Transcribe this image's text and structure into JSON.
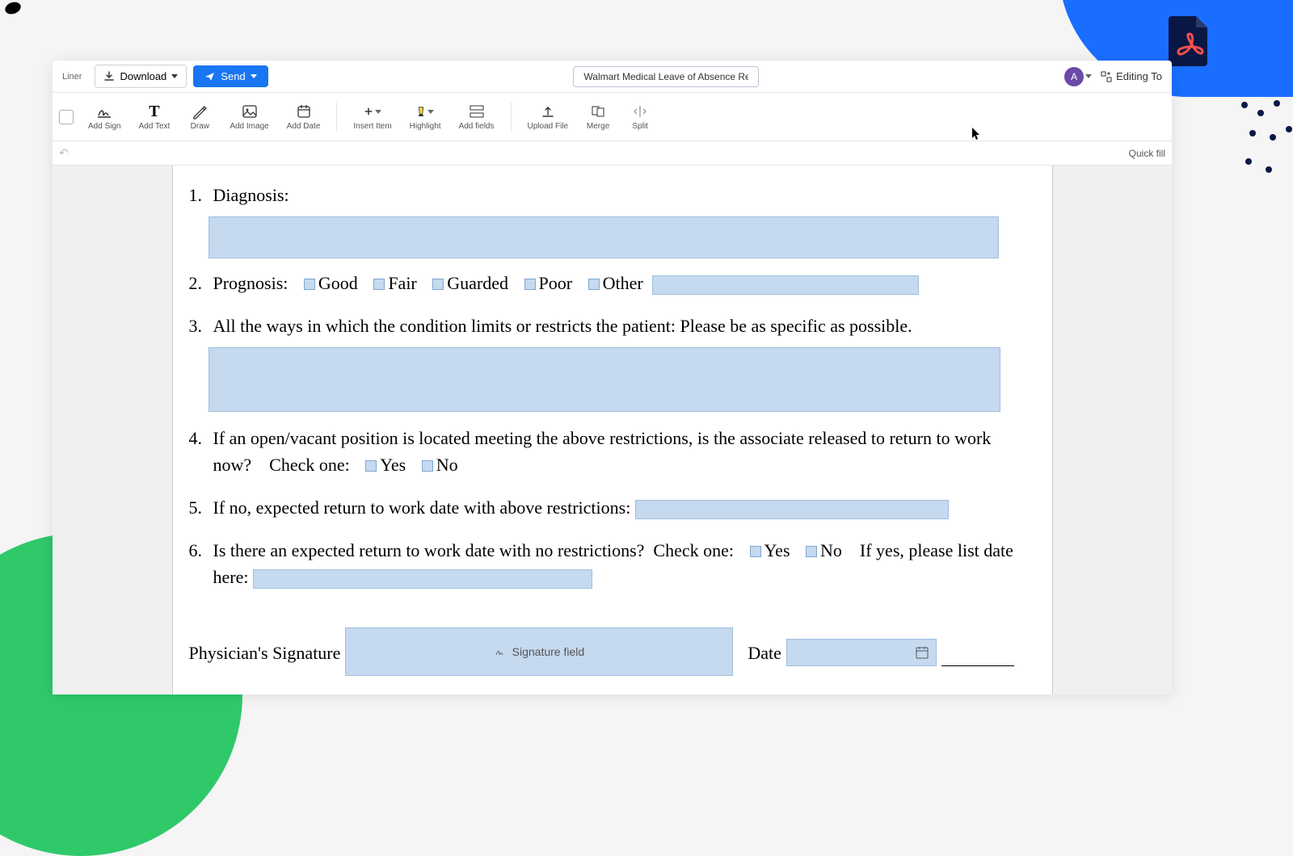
{
  "header": {
    "liner_label": "Liner",
    "download_label": "Download",
    "send_label": "Send",
    "document_title": "Walmart Medical Leave of Absence Request Form",
    "avatar_letter": "A",
    "editing_label": "Editing To"
  },
  "toolbar": {
    "add_sign": "Add Sign",
    "add_text": "Add Text",
    "draw": "Draw",
    "add_image": "Add Image",
    "add_date": "Add Date",
    "insert_item": "Insert Item",
    "highlight": "Highlight",
    "add_fields": "Add fields",
    "upload_file": "Upload File",
    "merge": "Merge",
    "split": "Split"
  },
  "subbar": {
    "quick_fill": "Quick fill"
  },
  "form": {
    "q1_num": "1.",
    "q1_label": "Diagnosis:",
    "q2_num": "2.",
    "q2_label": "Prognosis:",
    "q2_options": {
      "good": "Good",
      "fair": "Fair",
      "guarded": "Guarded",
      "poor": "Poor",
      "other": "Other"
    },
    "q3_num": "3.",
    "q3_label": "All the ways in which the condition limits or restricts the patient: Please be as specific as possible.",
    "q4_num": "4.",
    "q4_label_a": "If an open/vacant position is located meeting the above restrictions, is the associate released to return to work now?    Check one:",
    "q4_yes": "Yes",
    "q4_no": "No",
    "q5_num": "5.",
    "q5_label": "If no, expected return to work date with above restrictions:",
    "q6_num": "6.",
    "q6_label_a": "Is there an expected return to work date with no restrictions?  Check one:",
    "q6_yes": "Yes",
    "q6_no": "No",
    "q6_label_b": "If yes, please list date here:",
    "sig_label": "Physician's Signature",
    "sig_placeholder": "Signature field",
    "date_label": "Date"
  }
}
